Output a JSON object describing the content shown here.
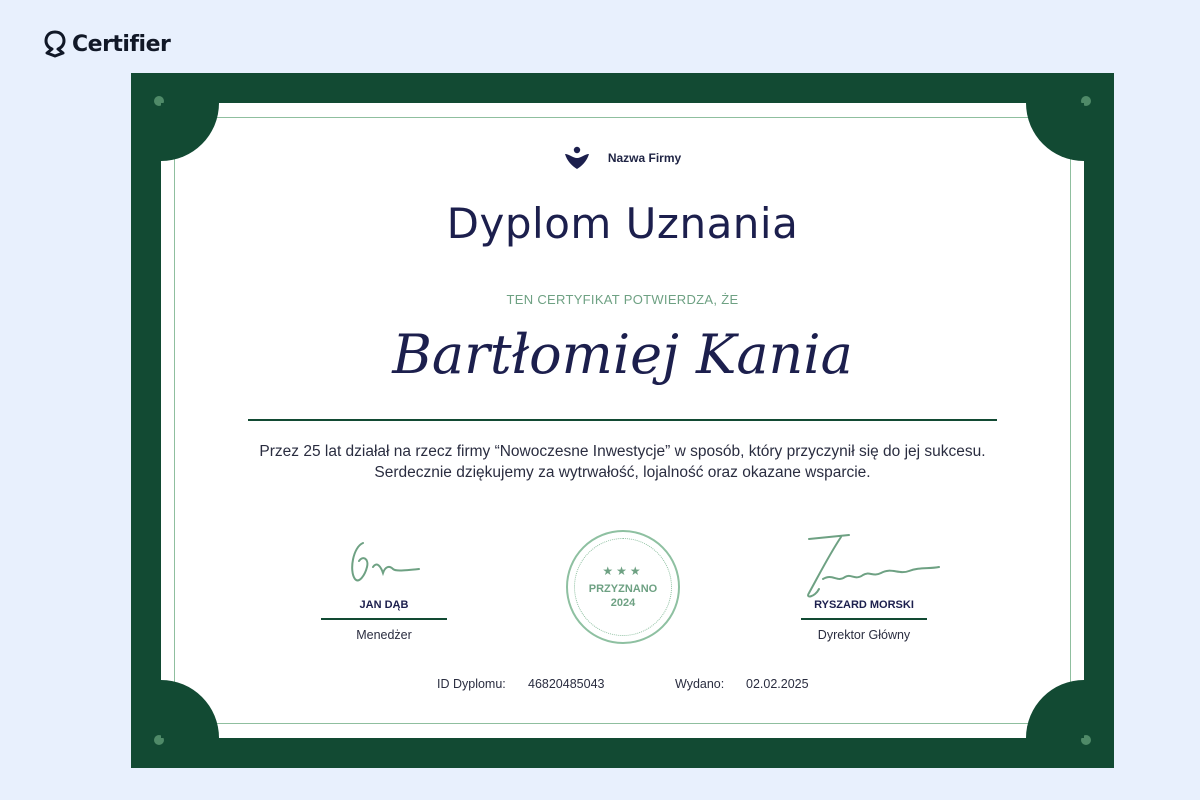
{
  "brand": {
    "name": "Certifier",
    "icon": "certifier-logo-icon"
  },
  "certificate": {
    "company_name": "Nazwa Firmy",
    "company_icon": "company-heart-logo-icon",
    "title": "Dyplom Uznania",
    "subtitle": "TEN CERTYFIKAT POTWIERDZA, ŻE",
    "recipient": "Bartłomiej Kania",
    "body": "Przez 25 lat działał na rzecz firmy “Nowoczesne Inwestycje” w sposób, który przyczynił się do jej sukcesu. Serdecznie dziękujemy za wytrwałość, lojalność oraz okazane wsparcie.",
    "signatures": [
      {
        "name": "JAN DĄB",
        "role": "Menedżer"
      },
      {
        "name": "RYSZARD MORSKI",
        "role": "Dyrektor Główny"
      }
    ],
    "seal": {
      "stars": "★★★",
      "label": "PRZYZNANO",
      "year": "2024"
    },
    "footer": {
      "id_label": "ID Dyplomu:",
      "id_value": "46820485043",
      "date_label": "Wydano:",
      "date_value": "02.02.2025"
    }
  },
  "colors": {
    "frame": "#124a33",
    "accent": "#6ea183",
    "ink": "#1c1f4d",
    "background": "#e8f0fd"
  }
}
